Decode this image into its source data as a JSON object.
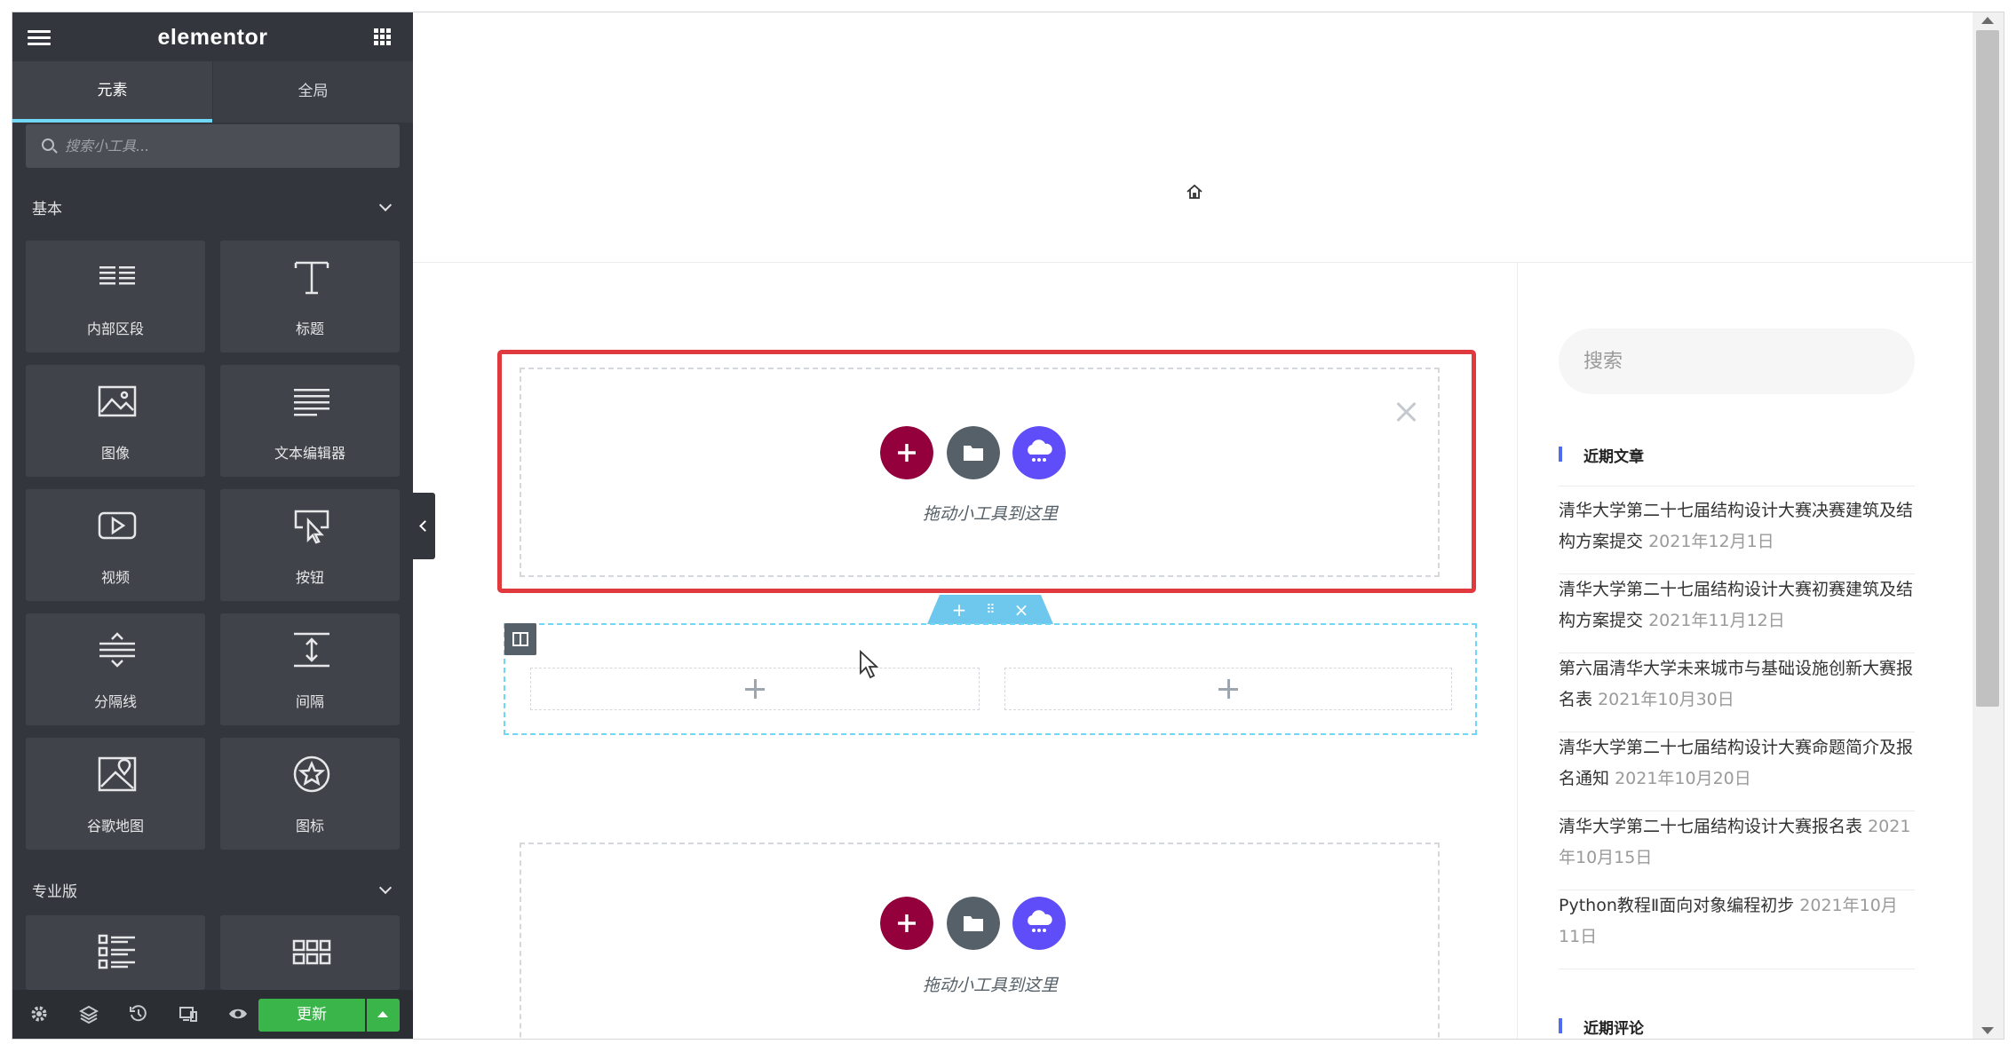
{
  "editor": {
    "logo": "elementor",
    "tabs": [
      {
        "label": "元素",
        "active": true
      },
      {
        "label": "全局",
        "active": false
      }
    ],
    "search": {
      "placeholder": "搜索小工具..."
    },
    "categories": [
      {
        "title": "基本",
        "widgets": [
          {
            "label": "内部区段",
            "icon": "inner-section-icon"
          },
          {
            "label": "标题",
            "icon": "heading-icon"
          },
          {
            "label": "图像",
            "icon": "image-icon"
          },
          {
            "label": "文本编辑器",
            "icon": "text-editor-icon"
          },
          {
            "label": "视频",
            "icon": "video-icon"
          },
          {
            "label": "按钮",
            "icon": "button-icon"
          },
          {
            "label": "分隔线",
            "icon": "divider-icon"
          },
          {
            "label": "间隔",
            "icon": "spacer-icon"
          },
          {
            "label": "谷歌地图",
            "icon": "google-maps-icon"
          },
          {
            "label": "图标",
            "icon": "star-icon"
          }
        ]
      },
      {
        "title": "专业版",
        "widgets": [
          {
            "label": "",
            "icon": "posts-icon"
          },
          {
            "label": "",
            "icon": "portfolio-icon"
          }
        ]
      }
    ],
    "footer": {
      "update_label": "更新",
      "icons": [
        "settings-icon",
        "navigator-icon",
        "history-icon",
        "responsive-icon",
        "preview-icon"
      ]
    }
  },
  "canvas": {
    "drop_text": "拖动小工具到这里",
    "colors": {
      "add": "#93003c",
      "template": "#556068",
      "ai": "#5f4dfa",
      "highlight": "#e0393e",
      "selected": "#71d7f7"
    },
    "sidebar": {
      "search_placeholder": "搜索",
      "recent_posts_title": "近期文章",
      "recent_posts": [
        {
          "title": "清华大学第二十七届结构设计大赛决赛建筑及结构方案提交",
          "date": "2021年12月1日"
        },
        {
          "title": "清华大学第二十七届结构设计大赛初赛建筑及结构方案提交",
          "date": "2021年11月12日"
        },
        {
          "title": "第六届清华大学未来城市与基础设施创新大赛报名表",
          "date": "2021年10月30日"
        },
        {
          "title": "清华大学第二十七届结构设计大赛命题简介及报名通知",
          "date": "2021年10月20日"
        },
        {
          "title": "清华大学第二十七届结构设计大赛报名表",
          "date": "2021年10月15日"
        },
        {
          "title": "Python教程Ⅱ面向对象编程初步",
          "date": "2021年10月11日"
        }
      ],
      "recent_comments_title": "近期评论"
    }
  }
}
